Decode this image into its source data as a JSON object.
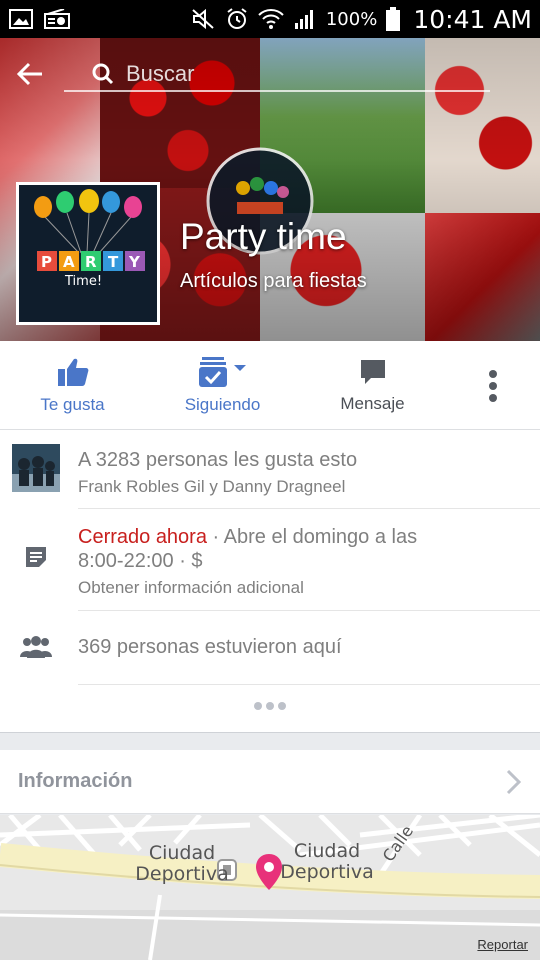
{
  "status_bar": {
    "icons": [
      "image-icon",
      "radio-icon",
      "mute-icon",
      "alarm-icon",
      "wifi-icon",
      "signal-icon"
    ],
    "battery": "100%",
    "time": "10:41 AM"
  },
  "header": {
    "search_placeholder": "Buscar"
  },
  "page": {
    "name": "Party time",
    "category": "Artículos para fiestas"
  },
  "actions": {
    "like_label": "Te gusta",
    "follow_label": "Siguiendo",
    "message_label": "Mensaje"
  },
  "about": {
    "likes_text": "A 3283 personas les gusta esto",
    "friends_text": "Frank Robles Gil y Danny Dragneel",
    "hours_status": "Cerrado ahora",
    "hours_detail_1": " · Abre el domingo a las",
    "hours_detail_2": "8:00-22:00 · $",
    "more_info": "Obtener información adicional",
    "checkins": "369 personas estuvieron aquí"
  },
  "information": {
    "label": "Información"
  },
  "map": {
    "place_left_1": "Ciudad",
    "place_left_2": "Deportiva",
    "place_right_1": "Ciudad",
    "place_right_2": "Deportiva",
    "street": "Calle",
    "report": "Reportar"
  },
  "colors": {
    "accent_blue": "#4a76c8",
    "closed_red": "#c8201e",
    "map_pin": "#e8317a"
  }
}
